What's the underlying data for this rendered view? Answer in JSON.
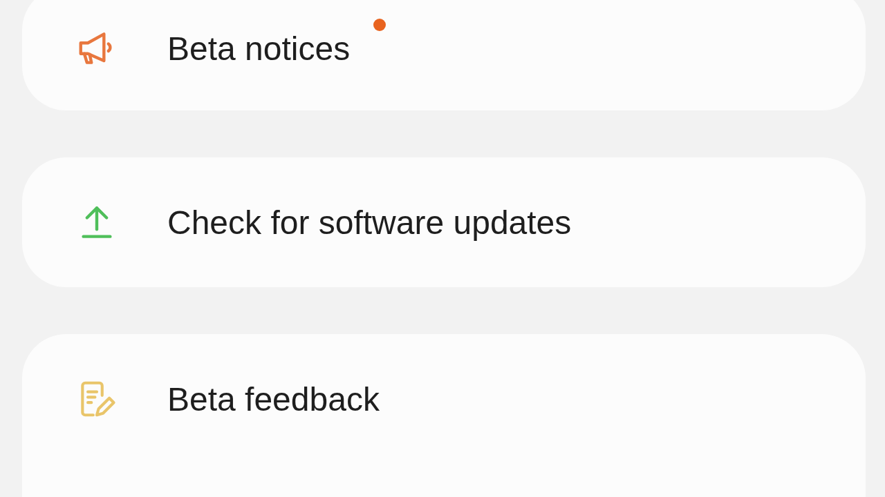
{
  "cards": [
    {
      "items": [
        {
          "kind": "megaphone",
          "label": "Beta notices",
          "new_badge": true
        }
      ]
    },
    {
      "items": [
        {
          "kind": "upload",
          "label": "Check for software updates",
          "new_badge": false
        }
      ]
    },
    {
      "items": [
        {
          "kind": "feedback",
          "label": "Beta feedback",
          "new_badge": false
        }
      ]
    }
  ]
}
